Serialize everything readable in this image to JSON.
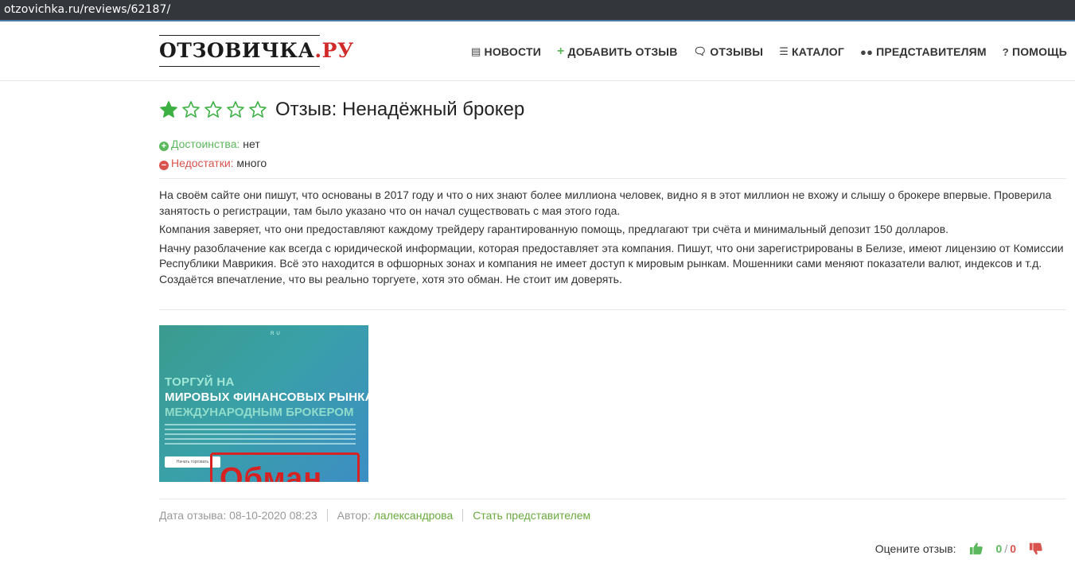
{
  "browser": {
    "url": "otzovichka.ru/reviews/62187/"
  },
  "header": {
    "logo_dark": "ОТЗОВИЧКА",
    "logo_red": ".РУ",
    "nav": [
      {
        "label": "НОВОСТИ",
        "icon": "newspaper-icon"
      },
      {
        "label": "ДОБАВИТЬ ОТЗЫВ",
        "icon": "plus-icon"
      },
      {
        "label": "ОТЗЫВЫ",
        "icon": "comments-icon"
      },
      {
        "label": "КАТАЛОГ",
        "icon": "list-icon"
      },
      {
        "label": "ПРЕДСТАВИТЕЛЯМ",
        "icon": "users-icon"
      },
      {
        "label": "ПОМОЩЬ",
        "icon": "question-icon"
      }
    ]
  },
  "review": {
    "rating": 1,
    "rating_max": 5,
    "title": "Отзыв: Ненадёжный брокер",
    "pros_label": "Достоинства:",
    "pros_value": "нет",
    "cons_label": "Недостатки:",
    "cons_value": "много",
    "paragraphs": [
      "На своём сайте они пишут, что основаны в 2017 году и что о них знают более миллиона человек, видно я в этот миллион не вхожу и слышу о брокере впервые. Проверила занятость о регистрации, там было указано что он начал существовать с мая этого года.",
      "Компания заверяет, что они предоставляют каждому трейдеру гарантированную помощь, предлагают три счёта и минимальный депозит 150 долларов.",
      "Начну разоблачение как всегда с юридической информации, которая предоставляет эта компания. Пишут, что они зарегистрированы в Белизе, имеют лицензию от Комиссии Республики Маврикия. Всё это находится в офшорных зонах и компания не имеет доступ к мировым рынкам. Мошенники сами меняют показатели валют, индексов и т.д. Создаётся впечатление, что вы реально торгуете, хотя это обман. Не стоит им доверять."
    ],
    "image": {
      "line1": "ТОРГУЙ НА",
      "line2": "МИРОВЫХ ФИНАНСОВЫХ РЫНКАХ",
      "line3": "МЕЖДУНАРОДНЫМ БРОКЕРОМ",
      "lang": "RU",
      "button": "Начать торговать",
      "stamp": "Обман"
    },
    "meta": {
      "date_label": "Дата отзыва:",
      "date": "08-10-2020 08:23",
      "author_label": "Автор:",
      "author": "лалександрова",
      "become_rep": "Стать представителем"
    },
    "rate": {
      "label": "Оцените отзыв:",
      "up": "0",
      "down": "0",
      "up_color": "#5cb85c",
      "down_color": "#d9534f"
    }
  },
  "colors": {
    "green": "#5cb85c",
    "red": "#d9534f",
    "star": "#3cb043"
  }
}
